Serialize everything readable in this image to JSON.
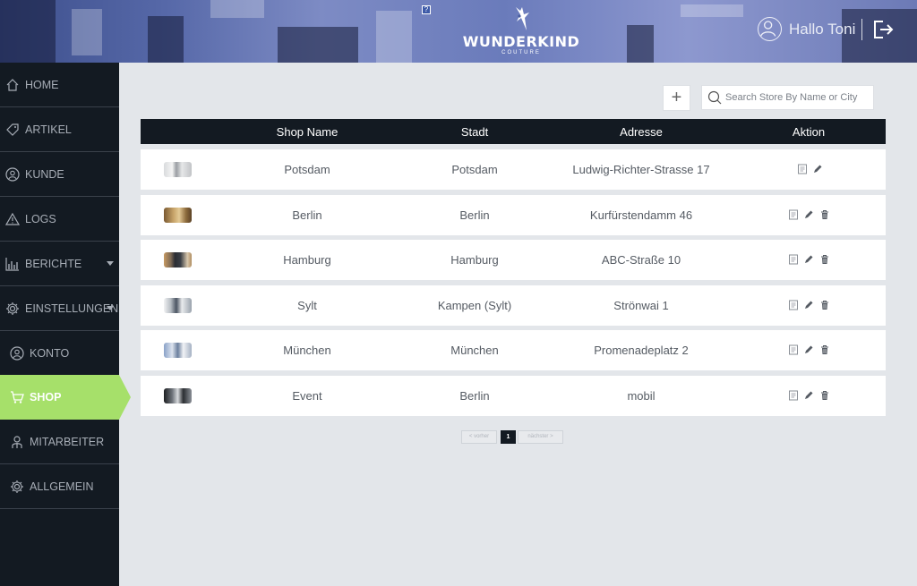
{
  "header": {
    "brand": "WUNDERKIND",
    "brand_sub": "COUTURE",
    "greeting": "Hallo Toni",
    "help_glyph": "?"
  },
  "sidebar": {
    "items": [
      {
        "label": "HOME",
        "icon": "home-icon"
      },
      {
        "label": "ARTIKEL",
        "icon": "tag-icon"
      },
      {
        "label": "KUNDE",
        "icon": "customer-icon"
      },
      {
        "label": "LOGS",
        "icon": "warning-icon"
      },
      {
        "label": "BERICHTE",
        "icon": "bar-chart-icon",
        "has_submenu": true
      },
      {
        "label": "EINSTELLUNGEN",
        "icon": "gear-icon",
        "has_submenu": true
      },
      {
        "label": "KONTO",
        "icon": "user-circle-icon"
      },
      {
        "label": "SHOP",
        "icon": "cart-icon",
        "active": true
      },
      {
        "label": "MITARBEITER",
        "icon": "employee-icon"
      },
      {
        "label": "ALLGEMEIN",
        "icon": "gear-icon"
      }
    ]
  },
  "toolbar": {
    "add_label": "+",
    "search_placeholder": "Search Store By Name or City"
  },
  "table": {
    "columns": [
      "Shop Name",
      "Stadt",
      "Adresse",
      "Aktion"
    ],
    "rows": [
      {
        "name": "Potsdam",
        "city": "Potsdam",
        "address": "Ludwig-Richter-Strasse 17",
        "deletable": false
      },
      {
        "name": "Berlin",
        "city": "Berlin",
        "address": "Kurfürstendamm 46",
        "deletable": true
      },
      {
        "name": "Hamburg",
        "city": "Hamburg",
        "address": "ABC-Straße 10",
        "deletable": true
      },
      {
        "name": "Sylt",
        "city": "Kampen (Sylt)",
        "address": "Strönwai 1",
        "deletable": true
      },
      {
        "name": "München",
        "city": "München",
        "address": "Promenadeplatz 2",
        "deletable": true
      },
      {
        "name": "Event",
        "city": "Berlin",
        "address": "mobil",
        "deletable": true
      }
    ]
  },
  "pagination": {
    "prev": "< vorher",
    "current": "1",
    "next": "nächster >"
  },
  "colors": {
    "accent": "#a6e06a",
    "sidebar_bg": "#131a22",
    "page_bg": "#e3e6ea"
  }
}
